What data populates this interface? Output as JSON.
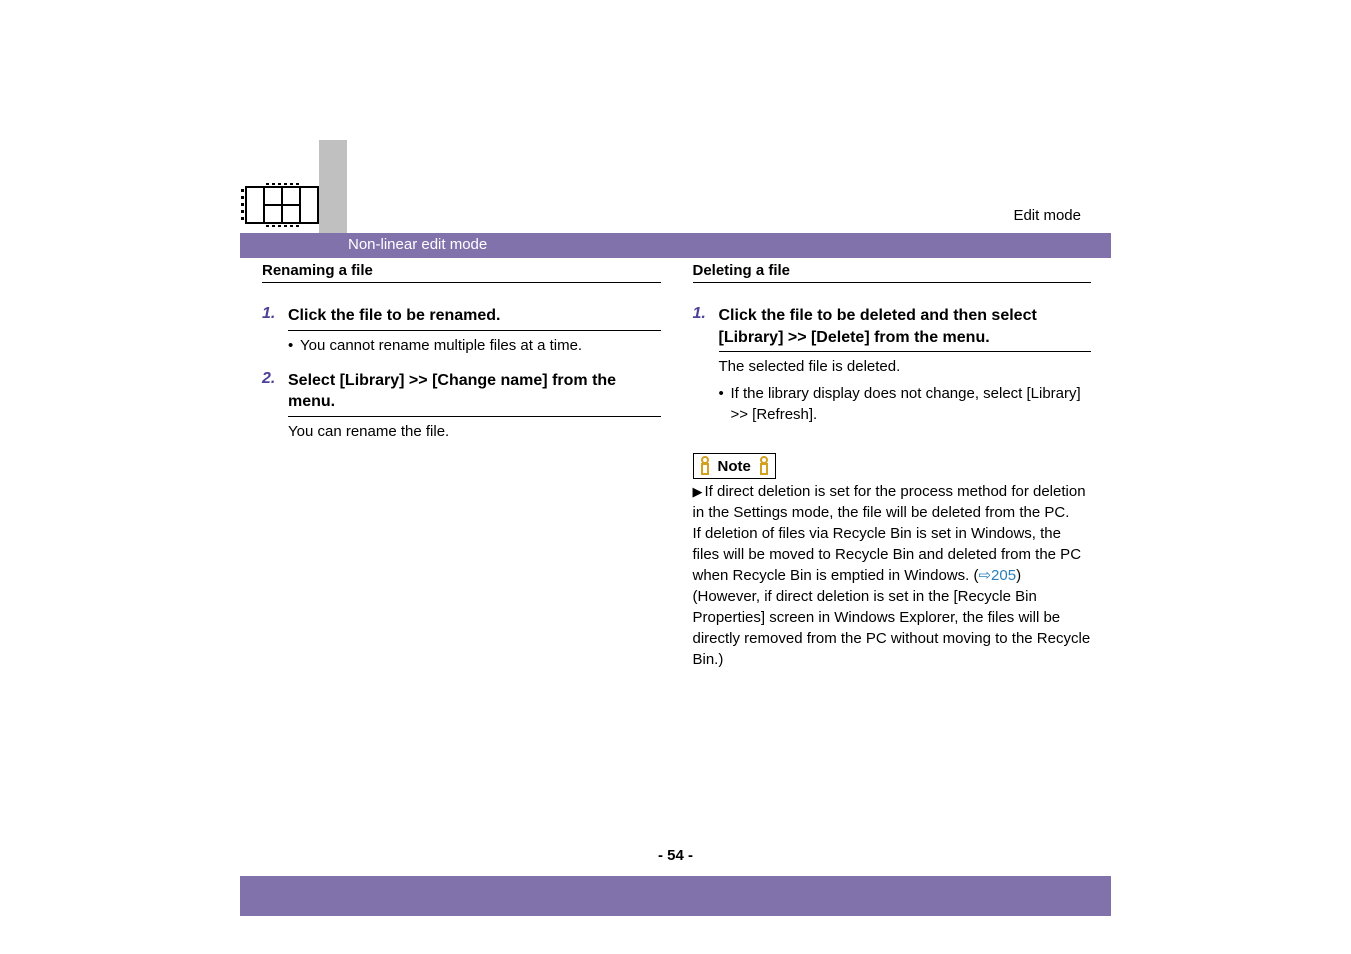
{
  "header": {
    "mode_label": "Edit mode",
    "bar_title": "Non-linear edit mode"
  },
  "left": {
    "section_title": "Renaming a file",
    "steps": [
      {
        "num": "1.",
        "heading": "Click the file to be renamed.",
        "bullets": [
          "You cannot rename multiple files at a time."
        ],
        "after": ""
      },
      {
        "num": "2.",
        "heading": "Select [Library] >> [Change name] from the menu.",
        "bullets": [],
        "after": "You can rename the file."
      }
    ]
  },
  "right": {
    "section_title": "Deleting a file",
    "steps": [
      {
        "num": "1.",
        "heading": "Click the file to be deleted and then select [Library] >> [Delete] from the menu.",
        "after": "The selected file is deleted.",
        "bullets": [
          "If the library display does not change, select [Library] >> [Refresh]."
        ]
      }
    ],
    "note_label": "Note",
    "note_para1": "If direct deletion is set for the process method for deletion in the Settings mode, the file will be deleted from the PC.",
    "note_para2_a": "If deletion of files via Recycle Bin is set in Windows, the files will be moved to Recycle Bin and deleted from the PC when Recycle Bin is emptied in Windows. (",
    "note_link_arrow": "⇨",
    "note_link_num": "205",
    "note_para2_b": ") (However, if direct deletion is set in the [Recycle Bin Properties] screen in Windows Explorer, the files will be directly removed from the PC without moving to the Recycle Bin.)"
  },
  "page_number": "- 54 -"
}
